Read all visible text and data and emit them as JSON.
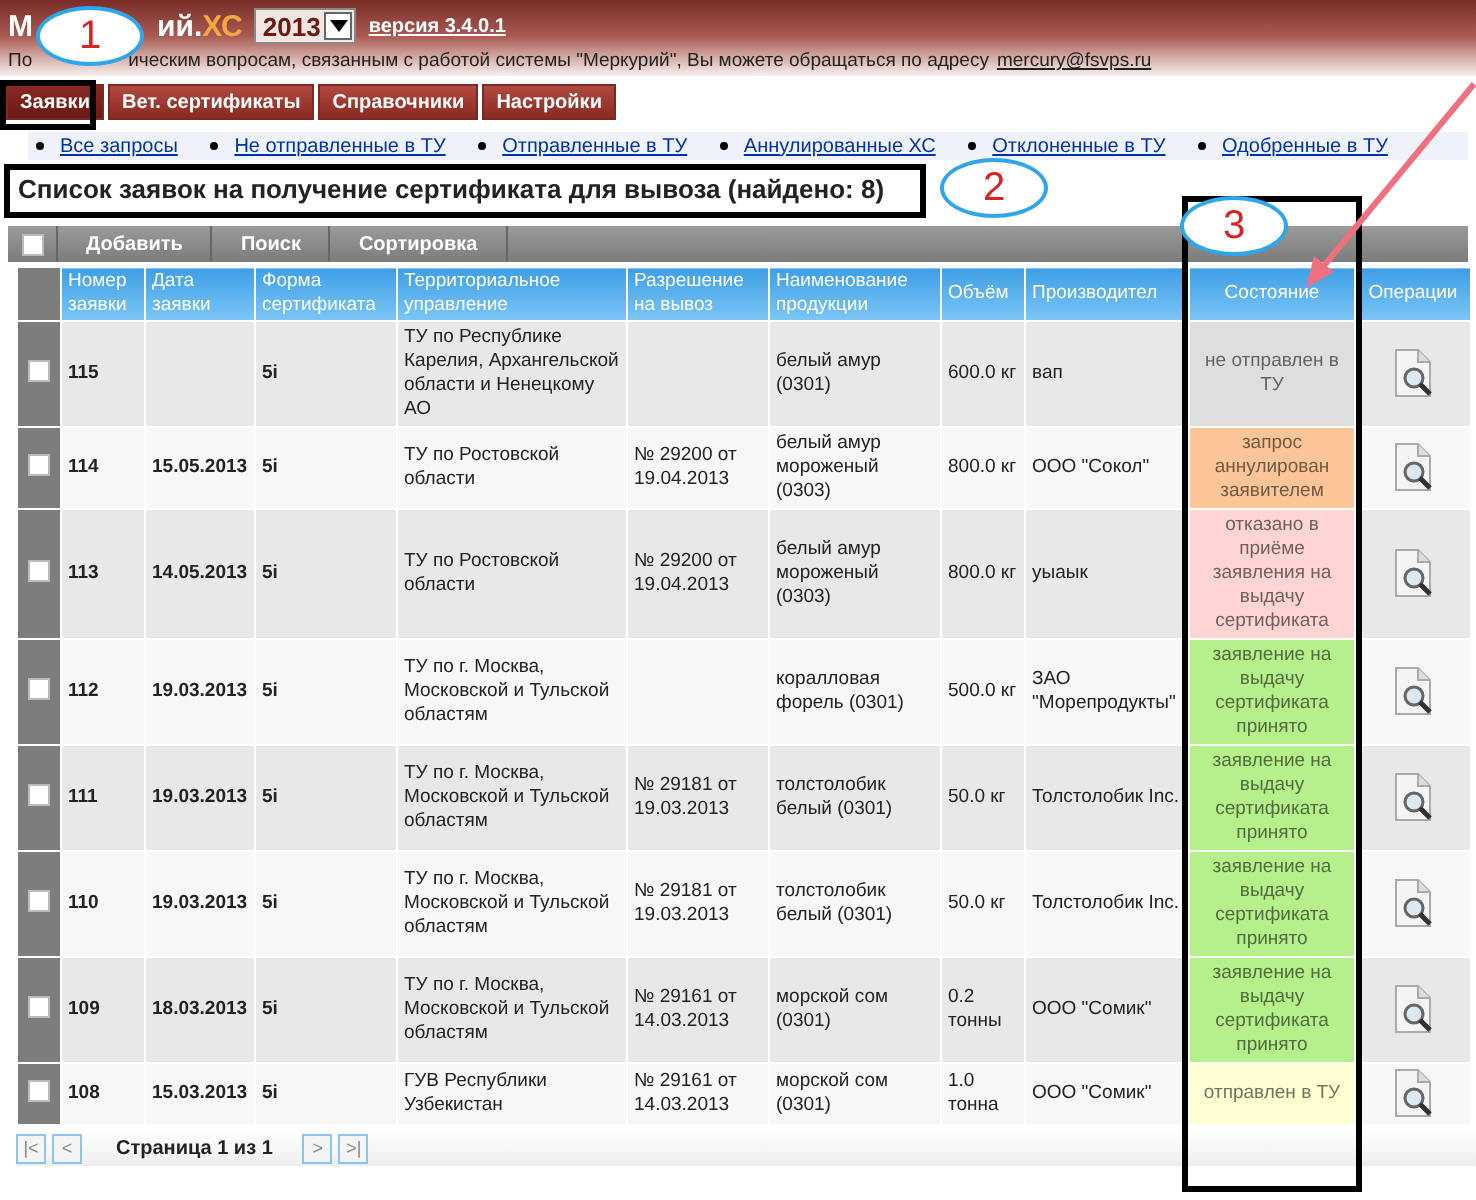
{
  "header": {
    "title_parts": [
      {
        "text": "М",
        "accent": false
      },
      {
        "text": "ий.",
        "accent": false
      },
      {
        "text": "ХС",
        "accent": true
      }
    ],
    "year": "2013",
    "version": "версия 3.4.0.1",
    "info_start": "По",
    "info_rest": "ическим вопросам, связанным с работой системы \"Меркурий\", Вы можете обращаться по адресу",
    "email": "mercury@fsvps.ru"
  },
  "tabs": [
    {
      "label": "Заявки",
      "selected": true
    },
    {
      "label": "Вет. сертификаты",
      "selected": false
    },
    {
      "label": "Справочники",
      "selected": false
    },
    {
      "label": "Настройки",
      "selected": false
    }
  ],
  "filters": [
    "Все запросы",
    "Не отправленные в ТУ",
    "Отправленные в ТУ",
    "Аннулированные ХС",
    "Отклоненные в ТУ",
    "Одобренные в ТУ"
  ],
  "page_title": "Список заявок на получение сертификата для вывоза (найдено: 8)",
  "toolbar": {
    "select_all_checked": false,
    "buttons": [
      "Добавить",
      "Поиск",
      "Сортировка"
    ]
  },
  "table": {
    "columns": [
      "Номер заявки",
      "Дата заявки",
      "Форма сертификата",
      "Территориальное управление",
      "Разрешение на вывоз",
      "Наименование продукции",
      "Объём",
      "Производител",
      "Состояние",
      "Операции"
    ],
    "rows": [
      {
        "checked": false,
        "number": "115",
        "date": "",
        "form": "5i",
        "office": "ТУ по Республике Карелия, Архангельской области и Ненецкому АО",
        "permit": "",
        "product": "белый амур (0301)",
        "volume": "600.0 кг",
        "producer": "вап",
        "status": "не отправлен в ТУ",
        "color": "#dedede"
      },
      {
        "checked": false,
        "number": "114",
        "date": "15.05.2013",
        "form": "5i",
        "office": "ТУ по Ростовской области",
        "permit": "№ 29200 от 19.04.2013",
        "product": "белый амур мороженый (0303)",
        "volume": "800.0 кг",
        "producer": "ООО \"Сокол\"",
        "status": "запрос аннулирован заявителем",
        "color": "#fcc597"
      },
      {
        "checked": false,
        "number": "113",
        "date": "14.05.2013",
        "form": "5i",
        "office": "ТУ по Ростовской области",
        "permit": "№ 29200 от 19.04.2013",
        "product": "белый амур мороженый (0303)",
        "volume": "800.0 кг",
        "producer": "уыаык",
        "status": "отказано в приёме заявления на выдачу сертификата",
        "color": "#ffd4d4"
      },
      {
        "checked": false,
        "number": "112",
        "date": "19.03.2013",
        "form": "5i",
        "office": "ТУ по г. Москва, Московской и Тульской областям",
        "permit": "",
        "product": "коралловая форель (0301)",
        "volume": "500.0 кг",
        "producer": "ЗАО \"Морепродукты\"",
        "status": "заявление на выдачу сертификата принято",
        "color": "#b5f08a"
      },
      {
        "checked": false,
        "number": "111",
        "date": "19.03.2013",
        "form": "5i",
        "office": "ТУ по г. Москва, Московской и Тульской областям",
        "permit": "№ 29181 от 19.03.2013",
        "product": "толстолобик белый (0301)",
        "volume": "50.0 кг",
        "producer": "Толстолобик Inc.",
        "status": "заявление на выдачу сертификата принято",
        "color": "#b5f08a"
      },
      {
        "checked": false,
        "number": "110",
        "date": "19.03.2013",
        "form": "5i",
        "office": "ТУ по г. Москва, Московской и Тульской областям",
        "permit": "№ 29181 от 19.03.2013",
        "product": "толстолобик белый (0301)",
        "volume": "50.0 кг",
        "producer": "Толстолобик Inc.",
        "status": "заявление на выдачу сертификата принято",
        "color": "#b5f08a"
      },
      {
        "checked": false,
        "number": "109",
        "date": "18.03.2013",
        "form": "5i",
        "office": "ТУ по г. Москва, Московской и Тульской областям",
        "permit": "№ 29161 от 14.03.2013",
        "product": "морской сом (0301)",
        "volume": "0.2 тонны",
        "producer": "ООО \"Сомик\"",
        "status": "заявление на выдачу сертификата принято",
        "color": "#b5f08a"
      },
      {
        "checked": false,
        "number": "108",
        "date": "15.03.2013",
        "form": "5i",
        "office": "ГУВ Республики Узбекистан",
        "permit": "№ 29161 от 14.03.2013",
        "product": "морской сом (0301)",
        "volume": "1.0 тонна",
        "producer": "ООО \"Сомик\"",
        "status": "отправлен в ТУ",
        "color": "#ffffd2"
      }
    ]
  },
  "pagination": {
    "first": "|<",
    "prev": "<",
    "page_label": "Страница 1 из 1",
    "next": ">",
    "last": ">|"
  },
  "annotations": [
    {
      "kind": "callout",
      "label": "1"
    },
    {
      "kind": "callout",
      "label": "2"
    },
    {
      "kind": "callout",
      "label": "3"
    }
  ]
}
